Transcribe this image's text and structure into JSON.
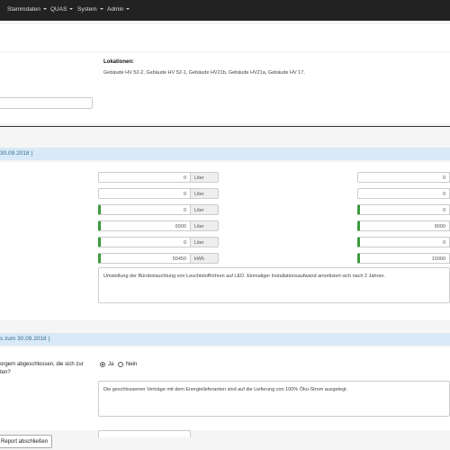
{
  "nav": {
    "items": [
      {
        "label": "Stammdaten"
      },
      {
        "label": "QUAS"
      },
      {
        "label": "System"
      },
      {
        "label": "Admin"
      }
    ]
  },
  "locations": {
    "heading": "Lokationen:",
    "value": "Gebäude HV 52-2, Gebäude HV 52-1, Gebäude HV21b, Gebäude HV21a, Gebäude HV 17,"
  },
  "section1": {
    "title": "30.09.2018 )",
    "rows": [
      {
        "value": "0",
        "unit": "Liter",
        "right_value": "0"
      },
      {
        "value": "0",
        "unit": "Liter",
        "right_value": "0"
      },
      {
        "value": "0",
        "unit": "Liter",
        "right_value": "0"
      },
      {
        "value": "6000",
        "unit": "Liter",
        "right_value": "9000"
      },
      {
        "value": "0",
        "unit": "Liter",
        "right_value": "0"
      },
      {
        "value": "50450",
        "unit": "kWh",
        "right_value": "10000"
      }
    ],
    "note": "Umstellung der Bürobelauchtung von Leuchtstoffröhren auf LED. Einmaliger Installationsaufwand amortisiert sich nach 2 Jahren."
  },
  "section2": {
    "title": "s zum 30.09.2018 )",
    "question_line1": "orgern abgeschlossen, die sich zur",
    "question_line2": "ten?",
    "radio_yes": "Ja",
    "radio_no": "Nein",
    "answer": "Die geschlossenen Verträge mit dem Energielieferanten sind auf die Lieferung von 100% Öko-Strom ausgelegt."
  },
  "footer": {
    "button_label": "Report abschließen"
  }
}
